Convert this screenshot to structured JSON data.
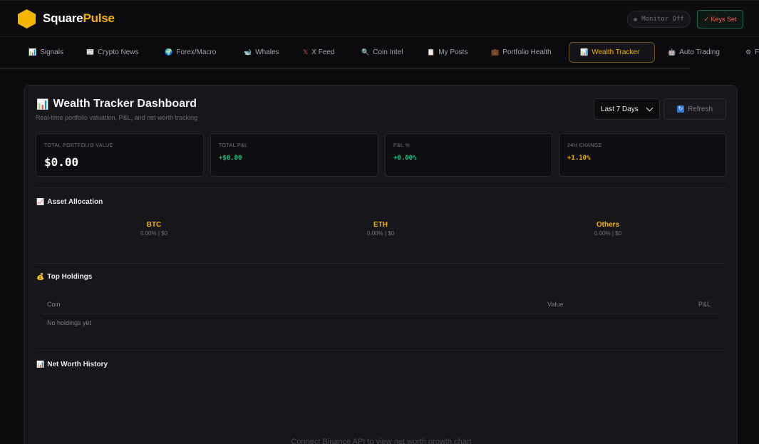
{
  "brand": {
    "part1": "Square",
    "part2": "Pulse"
  },
  "header": {
    "monitor_label": "Monitor Off",
    "keys_label": "✓ Keys Set"
  },
  "tabs": [
    {
      "icon": "📊",
      "label": "Signals"
    },
    {
      "icon": "📰",
      "label": "Crypto News"
    },
    {
      "icon": "🌍",
      "label": "Forex/Macro"
    },
    {
      "icon": "🐋",
      "label": "Whales"
    },
    {
      "icon": "𝕏",
      "label": "X Feed"
    },
    {
      "icon": "🔍",
      "label": "Coin Intel"
    },
    {
      "icon": "📋",
      "label": "My Posts"
    },
    {
      "icon": "💼",
      "label": "Portfolio Health"
    },
    {
      "icon": "📊",
      "label": "Wealth Tracker"
    },
    {
      "icon": "🤖",
      "label": "Auto Trading"
    },
    {
      "icon": "⚙",
      "label": "F"
    }
  ],
  "active_tab": "Wealth Tracker",
  "dashboard": {
    "icon": "📊",
    "title": "Wealth Tracker Dashboard",
    "subtitle": "Real-time portfolio valuation, P&L, and net worth tracking",
    "range": "Last 7 Days",
    "refresh_icon": "🔄",
    "refresh_label": "Refresh"
  },
  "stats": {
    "total_value": {
      "label": "TOTAL PORTFOLIO VALUE",
      "value": "$0.00"
    },
    "total_pnl": {
      "label": "TOTAL P&L",
      "value": "+$0.00"
    },
    "pnl_pct": {
      "label": "P&L %",
      "value": "+0.00%"
    },
    "change_24h": {
      "label": "24H CHANGE",
      "value": "+1.10%"
    }
  },
  "allocation": {
    "icon": "📈",
    "title": "Asset Allocation",
    "items": [
      {
        "name": "BTC",
        "detail": "0.00% | $0"
      },
      {
        "name": "ETH",
        "detail": "0.00% | $0"
      },
      {
        "name": "Others",
        "detail": "0.00% | $0"
      }
    ]
  },
  "holdings": {
    "icon": "💰",
    "title": "Top Holdings",
    "columns": [
      "Coin",
      "Value",
      "P&L"
    ],
    "empty": "No holdings yet"
  },
  "networth": {
    "icon": "📊",
    "title": "Net Worth History",
    "empty": "Connect Binance API to view net worth growth chart"
  },
  "colors": {
    "accent": "#f5b400",
    "positive": "#17c784",
    "background": "#0b0b0e",
    "card": "#16161b"
  }
}
